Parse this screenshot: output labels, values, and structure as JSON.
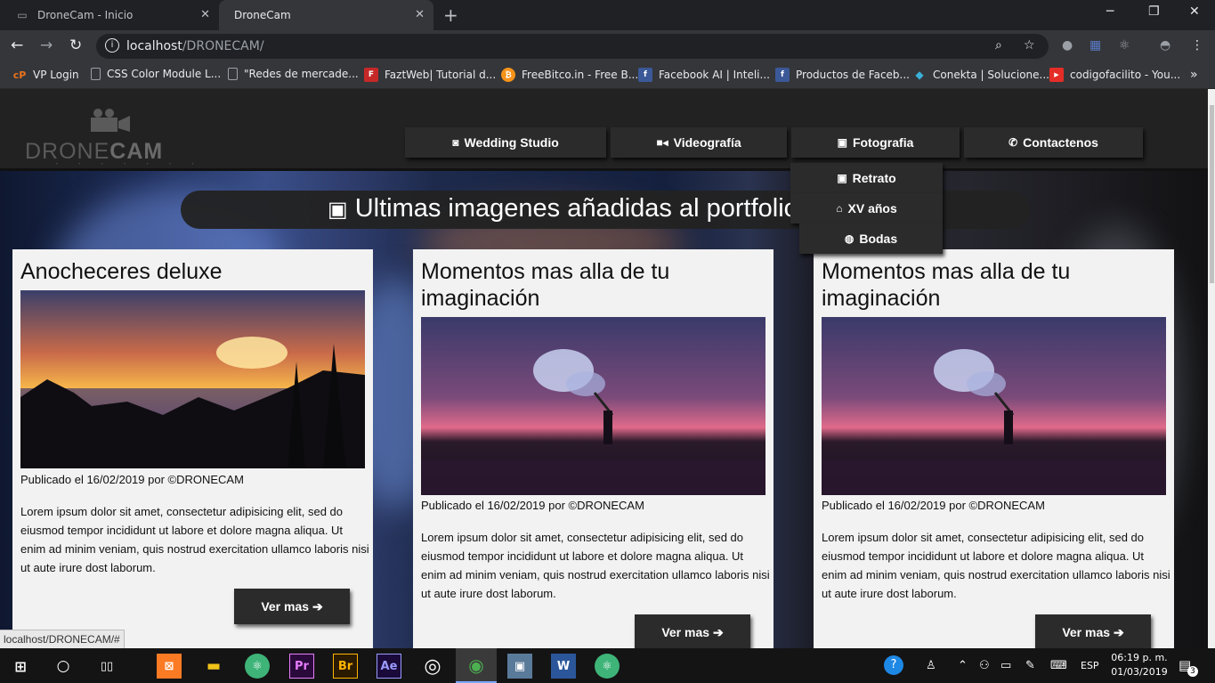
{
  "browser": {
    "tabs": [
      {
        "title": "DroneCam - Inicio",
        "active": false
      },
      {
        "title": "DroneCam",
        "active": true
      }
    ],
    "new_tab": "+",
    "window_controls": {
      "minimize": "─",
      "restore": "❐",
      "close": "✕"
    },
    "url_host": "localhost",
    "url_path": "/DRONECAM/",
    "bookmarks": [
      {
        "label": "VP Login",
        "icon": "cp-icon",
        "badge": "cP",
        "color": "#e8731c"
      },
      {
        "label": "CSS Color Module L...",
        "icon": "page-icon",
        "badge": "",
        "color": "#35363a"
      },
      {
        "label": "\"Redes de mercade...",
        "icon": "page-icon",
        "badge": "",
        "color": "#35363a"
      },
      {
        "label": "FaztWeb| Tutorial d...",
        "icon": "faztweb-icon",
        "badge": "F",
        "color": "#c62828"
      },
      {
        "label": "FreeBitco.in - Free B...",
        "icon": "bitcoin-icon",
        "badge": "₿",
        "color": "#f7931a"
      },
      {
        "label": "Facebook AI | Inteli...",
        "icon": "facebook-icon",
        "badge": "f",
        "color": "#3b5998"
      },
      {
        "label": "Productos de Faceb...",
        "icon": "facebook-icon",
        "badge": "f",
        "color": "#3b5998"
      },
      {
        "label": "Conekta | Solucione...",
        "icon": "conekta-icon",
        "badge": "◆",
        "color": "#35363a"
      },
      {
        "label": "codigofacilito - You...",
        "icon": "youtube-icon",
        "badge": "▶",
        "color": "#e52d27"
      }
    ],
    "bookmarks_more": "»",
    "status_url": "localhost/DRONECAM/#"
  },
  "site": {
    "logo_text_light": "DRONE",
    "logo_text_bold": "CAM",
    "nav": [
      {
        "label": "Wedding Studio",
        "icon": "camera-icon",
        "glyph": "📷"
      },
      {
        "label": "Videografía",
        "icon": "video-icon",
        "glyph": "■"
      },
      {
        "label": "Fotografia",
        "icon": "image-icon",
        "glyph": "▣"
      },
      {
        "label": "Contactenos",
        "icon": "phone-icon",
        "glyph": "✆"
      }
    ],
    "dropdown": [
      {
        "label": "Retrato",
        "icon": "image-icon",
        "glyph": "▣"
      },
      {
        "label": "XV años",
        "icon": "gamepad-icon",
        "glyph": "⌂"
      },
      {
        "label": "Bodas",
        "icon": "globe-icon",
        "glyph": "◍"
      }
    ],
    "banner": {
      "title": "Ultimas imagenes añadidas al portfolio",
      "icon": "images-icon",
      "glyph": "▣"
    },
    "cards": [
      {
        "title": "Anocheceres deluxe",
        "image": "sunset",
        "meta": "Publicado el 16/02/2019 por ©DRONECAM",
        "body": "Lorem ipsum dolor sit amet, consectetur adipisicing elit, sed do eiusmod tempor incididunt ut labore et dolore magna aliqua. Ut enim ad minim veniam, quis nostrud exercitation ullamco laboris nisi ut aute irure dost laborum.",
        "button": "Ver mas"
      },
      {
        "title": "Momentos mas alla de tu imaginación",
        "image": "smoke",
        "meta": "Publicado el 16/02/2019 por ©DRONECAM",
        "body": "Lorem ipsum dolor sit amet, consectetur adipisicing elit, sed do eiusmod tempor incididunt ut labore et dolore magna aliqua. Ut enim ad minim veniam, quis nostrud exercitation ullamco laboris nisi ut aute irure dost laborum.",
        "button": "Ver mas"
      },
      {
        "title": "Momentos mas alla de tu imaginación",
        "image": "smoke",
        "meta": "Publicado el 16/02/2019 por ©DRONECAM",
        "body": "Lorem ipsum dolor sit amet, consectetur adipisicing elit, sed do eiusmod tempor incididunt ut labore et dolore magna aliqua. Ut enim ad minim veniam, quis nostrud exercitation ullamco laboris nisi ut aute irure dost laborum.",
        "button": "Ver mas"
      }
    ],
    "more_arrow": "➔"
  },
  "taskbar": {
    "apps": [
      {
        "name": "xampp-icon",
        "label": "⊠",
        "color": "#fb7a24"
      },
      {
        "name": "file-explorer-icon",
        "label": "▬",
        "color": "#f0c419"
      },
      {
        "name": "atom-icon",
        "label": "⚛",
        "color": "#3eb478"
      },
      {
        "name": "premiere-icon",
        "label": "Pr",
        "color": "#2a0a3a"
      },
      {
        "name": "bridge-icon",
        "label": "Br",
        "color": "#2a1a00"
      },
      {
        "name": "after-effects-icon",
        "label": "Ae",
        "color": "#1a0a3a"
      },
      {
        "name": "target-icon",
        "label": "◎",
        "color": "#141414"
      },
      {
        "name": "chrome-icon",
        "label": "◉",
        "color": "#3a3a3a"
      },
      {
        "name": "image-viewer-icon",
        "label": "▣",
        "color": "#5a7a9a"
      },
      {
        "name": "word-icon",
        "label": "W",
        "color": "#2b579a"
      },
      {
        "name": "atom-icon-2",
        "label": "⚛",
        "color": "#3eb478"
      }
    ],
    "language": "ESP",
    "time": "06:19 p. m.",
    "date": "01/03/2019",
    "notifications": "3"
  }
}
